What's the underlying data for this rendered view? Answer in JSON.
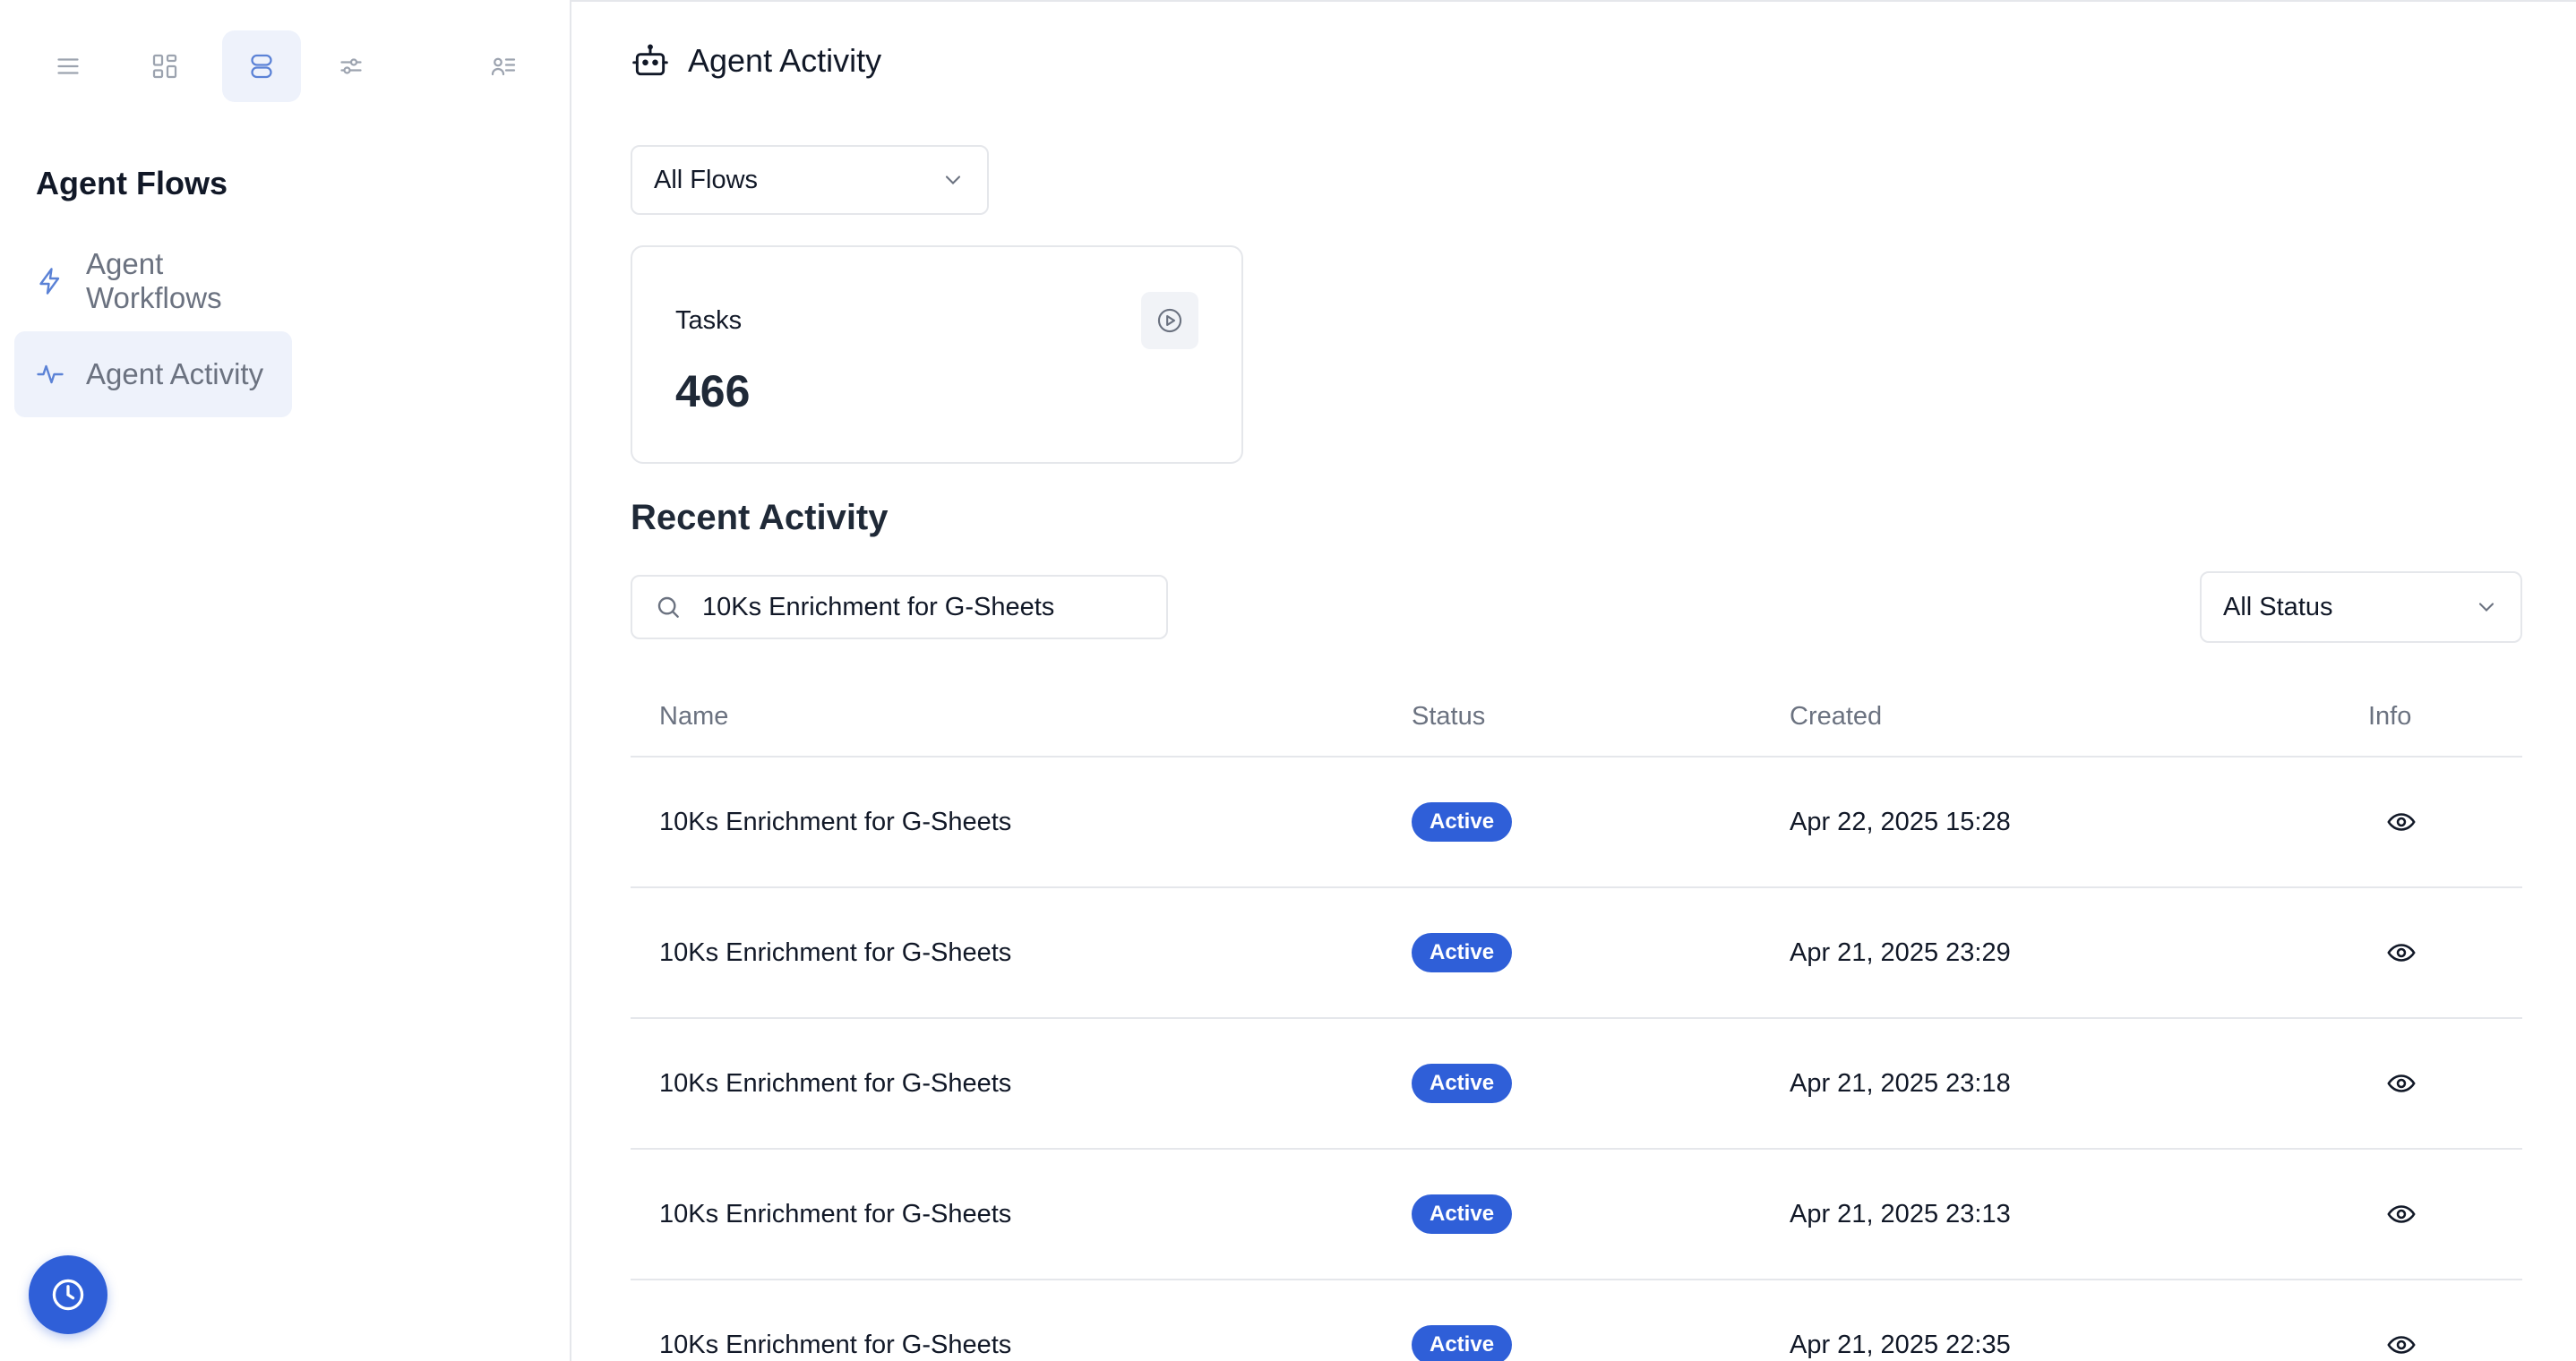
{
  "sidebar": {
    "section_title": "Agent Flows",
    "items": [
      {
        "label": "Agent Workflows",
        "icon": "bolt-icon",
        "active": false
      },
      {
        "label": "Agent Activity",
        "icon": "activity-icon",
        "active": true
      }
    ],
    "top_icons": [
      "menu-icon",
      "dashboard-icon",
      "database-icon",
      "sliders-icon",
      "contacts-icon"
    ],
    "fab_icon": "clock-icon"
  },
  "header": {
    "title": "Agent Activity",
    "icon": "robot-icon"
  },
  "flow_filter": {
    "selected": "All Flows"
  },
  "tasks_card": {
    "label": "Tasks",
    "value": "466",
    "icon": "play-circle-icon"
  },
  "recent": {
    "title": "Recent Activity",
    "search_value": "10Ks Enrichment for G-Sheets",
    "status_filter": "All Status",
    "columns": [
      "Name",
      "Status",
      "Created",
      "Info"
    ],
    "rows": [
      {
        "name": "10Ks Enrichment for G-Sheets",
        "status": "Active",
        "created": "Apr 22, 2025 15:28"
      },
      {
        "name": "10Ks Enrichment for G-Sheets",
        "status": "Active",
        "created": "Apr 21, 2025 23:29"
      },
      {
        "name": "10Ks Enrichment for G-Sheets",
        "status": "Active",
        "created": "Apr 21, 2025 23:18"
      },
      {
        "name": "10Ks Enrichment for G-Sheets",
        "status": "Active",
        "created": "Apr 21, 2025 23:13"
      },
      {
        "name": "10Ks Enrichment for G-Sheets",
        "status": "Active",
        "created": "Apr 21, 2025 22:35"
      }
    ]
  },
  "colors": {
    "accent": "#2f5fd8",
    "active_bg": "#eef2fb",
    "border": "#e5e7eb"
  }
}
